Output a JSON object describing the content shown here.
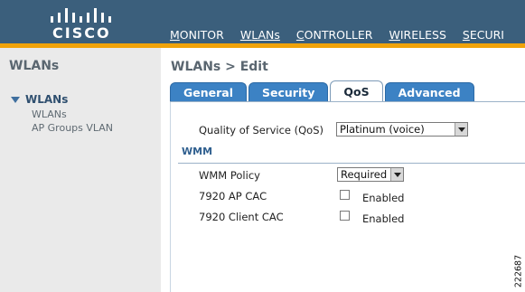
{
  "brand": {
    "logo_text": "CISCO"
  },
  "menu": {
    "items": [
      {
        "first": "M",
        "rest": "ONITOR"
      },
      {
        "first": "W",
        "rest": "LANs"
      },
      {
        "first": "C",
        "rest": "ONTROLLER"
      },
      {
        "first": "W",
        "rest": "IRELESS"
      },
      {
        "first": "S",
        "rest": "ECURI"
      }
    ]
  },
  "sidebar": {
    "title": "WLANs",
    "group_label": "WLANs",
    "links": [
      "WLANs",
      "AP Groups VLAN"
    ]
  },
  "main": {
    "page_title": "WLANs > Edit",
    "tabs": [
      {
        "label": "General",
        "active": false
      },
      {
        "label": "Security",
        "active": false
      },
      {
        "label": "QoS",
        "active": true
      },
      {
        "label": "Advanced",
        "active": false
      }
    ],
    "qos": {
      "label": "Quality of Service (QoS)",
      "value": "Platinum (voice)"
    },
    "wmm": {
      "heading": "WMM",
      "policy_label": "WMM Policy",
      "policy_value": "Required",
      "ap_cac_label": "7920 AP CAC",
      "ap_cac_checkbox_label": "Enabled",
      "client_cac_label": "7920 Client CAC",
      "client_cac_checkbox_label": "Enabled"
    }
  },
  "figure_code": "222687",
  "colors": {
    "header_bg": "#3b5f7c",
    "accent_orange": "#f0a30a",
    "tab_blue": "#3c82c4",
    "sidebar_bg": "#eaeaea"
  }
}
